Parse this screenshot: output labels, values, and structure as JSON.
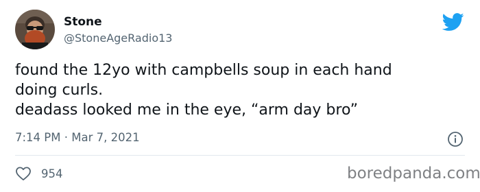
{
  "user": {
    "display_name": "Stone",
    "handle": "@StoneAgeRadio13"
  },
  "tweet": {
    "lines": [
      "found the 12yo with campbells soup in each hand",
      "doing curls.",
      "deadass looked me in the eye, “arm day bro”"
    ],
    "timestamp": "7:14 PM · Mar 7, 2021",
    "likes": "954"
  },
  "watermark": "boredpanda.com",
  "icons": {
    "brand": "twitter-bird-icon",
    "info": "info-icon",
    "like": "heart-icon"
  },
  "colors": {
    "twitter_blue": "#1da1f2",
    "text": "#0f1419",
    "muted": "#536471",
    "divider": "#e1e8ed"
  }
}
